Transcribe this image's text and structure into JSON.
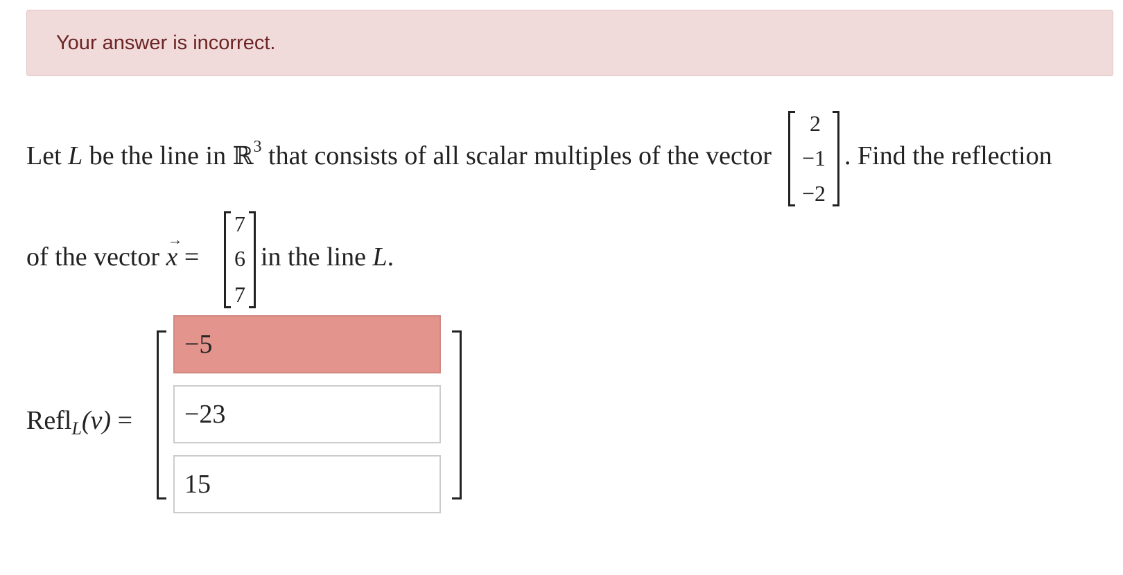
{
  "feedback": {
    "message": "Your answer is incorrect."
  },
  "question": {
    "line1_part1": "Let ",
    "line_symbol": "L",
    "line1_part2": " be the line in ",
    "reals": "ℝ",
    "dimension": "3",
    "line1_part3": " that consists of all scalar multiples of the vector",
    "line1_part4": ". Find the reflection",
    "line2_part1": "of the vector ",
    "vector_var": "x",
    "vector_arrow": "→",
    "equals": "=",
    "line2_part2": " in the line ",
    "line2_symbol": "L",
    "period": ".",
    "direction_vector": [
      "2",
      "−1",
      "−2"
    ],
    "x_vector": [
      "7",
      "6",
      "7"
    ]
  },
  "answer": {
    "label_text": "Refl",
    "label_sub": "L",
    "label_arg": "(v)",
    "label_equals": "=",
    "inputs": [
      {
        "value": "−5",
        "status": "incorrect"
      },
      {
        "value": "−23",
        "status": "neutral"
      },
      {
        "value": "15",
        "status": "neutral"
      }
    ]
  },
  "colors": {
    "alert_bg": "#f0dada",
    "alert_text": "#6b2424",
    "incorrect_fill": "#e3958d"
  }
}
